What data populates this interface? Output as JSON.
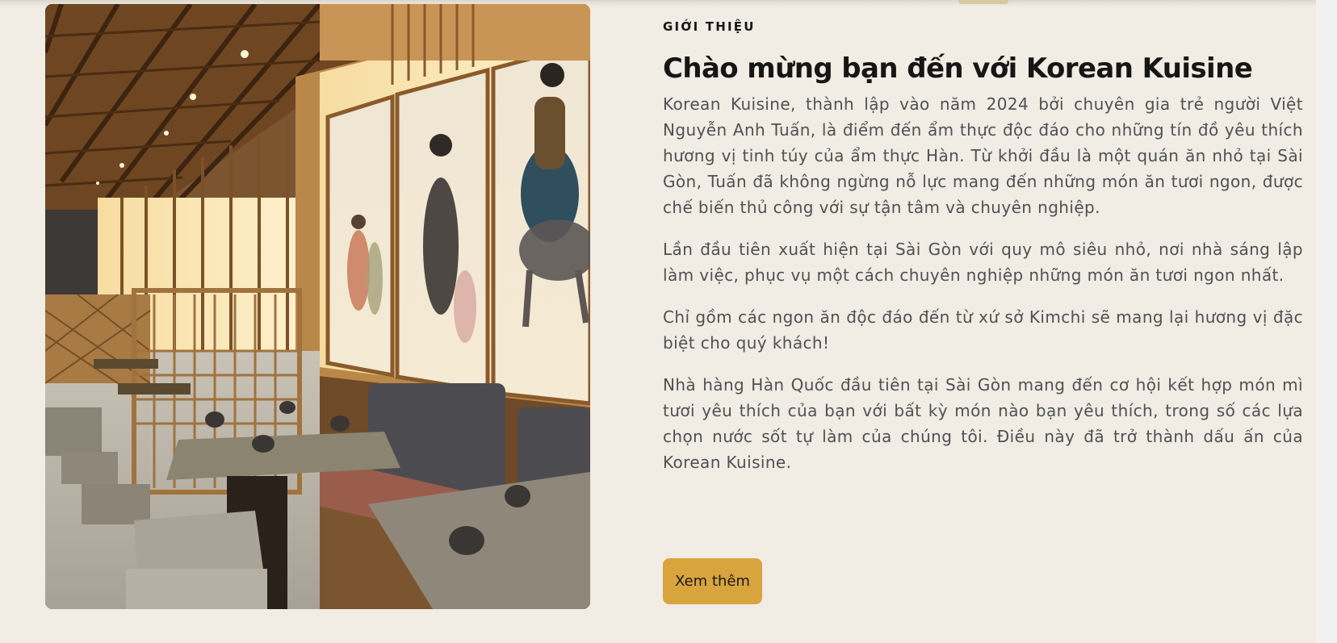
{
  "about": {
    "eyebrow": "GIỚI THIỆU",
    "title": "Chào mừng bạn đến với Korean Kuisine",
    "paragraphs": [
      "Korean Kuisine, thành lập vào năm 2024 bởi chuyên gia trẻ người Việt Nguyễn Anh Tuấn, là điểm đến ẩm thực độc đáo cho những tín đồ yêu thích hương vị tinh túy của ẩm thực Hàn. Từ khởi đầu là một quán ăn nhỏ tại Sài Gòn, Tuấn đã không ngừng nỗ lực mang đến những món ăn tươi ngon, được chế biến thủ công với sự tận tâm và chuyên nghiệp.",
      "Lần đầu tiên xuất hiện tại Sài Gòn với quy mô siêu nhỏ, nơi nhà sáng lập làm việc, phục vụ một cách chuyên nghiệp những món ăn tươi ngon nhất.",
      "Chỉ gồm các ngon ăn độc đáo đến từ xứ sở Kimchi sẽ mang lại hương vị đặc biệt cho quý khách!",
      "Nhà hàng Hàn Quốc đầu tiên tại Sài Gòn mang đến cơ hội kết hợp món mì tươi yêu thích của bạn với bất kỳ món nào bạn yêu thích, trong số các lựa chọn nước sốt tự làm của chúng tôi. Điều này đã trở thành dấu ấn của Korean Kuisine."
    ],
    "button_label": "Xem thêm"
  },
  "colors": {
    "background": "#f1ece4",
    "accent": "#d8a43e",
    "heading": "#161616",
    "body_text": "#4f5154"
  }
}
